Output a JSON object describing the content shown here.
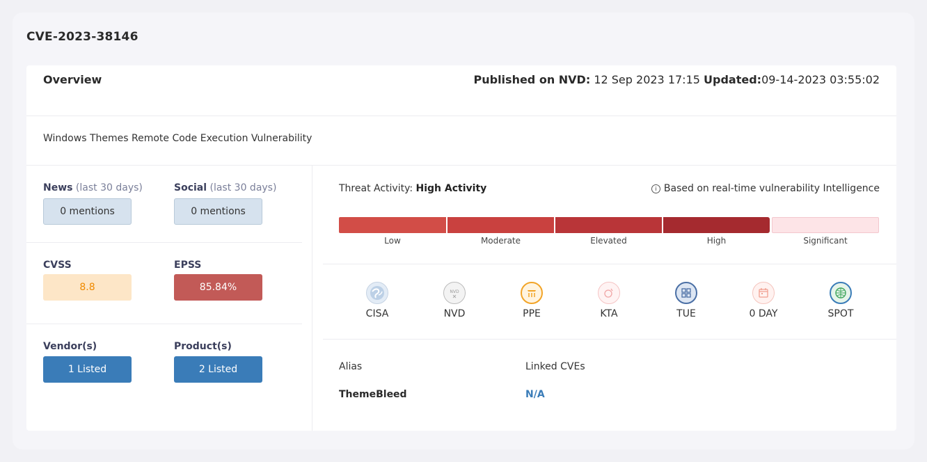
{
  "cve_id": "CVE-2023-38146",
  "overview": {
    "title": "Overview",
    "published_label": "Published on NVD:",
    "published_value": " 12 Sep 2023 17:15 ",
    "updated_label": "Updated:",
    "updated_value": "09-14-2023 03:55:02"
  },
  "description": "Windows Themes Remote Code Execution Vulnerability",
  "left_panel": {
    "news_label": "News",
    "news_period": " (last 30 days)",
    "news_value": "0 mentions",
    "social_label": "Social",
    "social_period": " (last 30 days)",
    "social_value": "0 mentions",
    "cvss_label": "CVSS",
    "cvss_value": "8.8",
    "epss_label": "EPSS",
    "epss_value": "85.84%",
    "vendor_label": "Vendor(s)",
    "vendor_value": "1 Listed",
    "product_label": "Product(s)",
    "product_value": "2 Listed"
  },
  "threat": {
    "label": "Threat Activity: ",
    "value": "High Activity",
    "based_on": "Based on real-time vulnerability Intelligence",
    "levels": [
      {
        "label": "Low",
        "color": "#d24d47"
      },
      {
        "label": "Moderate",
        "color": "#c9413f"
      },
      {
        "label": "Elevated",
        "color": "#b93538"
      },
      {
        "label": "High",
        "color": "#a52a2f"
      },
      {
        "label": "Significant",
        "color": "#fde4e7"
      }
    ]
  },
  "sources": [
    {
      "name": "CISA",
      "icon": "cisa-globe-icon"
    },
    {
      "name": "NVD",
      "icon": "nvd-icon"
    },
    {
      "name": "PPE",
      "icon": "ppe-icon"
    },
    {
      "name": "KTA",
      "icon": "kta-icon"
    },
    {
      "name": "TUE",
      "icon": "tue-grid-icon"
    },
    {
      "name": "0 DAY",
      "icon": "zero-day-calendar-icon"
    },
    {
      "name": "SPOT",
      "icon": "spot-globe-icon"
    }
  ],
  "alias": {
    "alias_label": "Alias",
    "alias_value": "ThemeBleed",
    "linked_label": "Linked CVEs",
    "linked_value": "N/A",
    "link_color": "#3a7cb8"
  }
}
